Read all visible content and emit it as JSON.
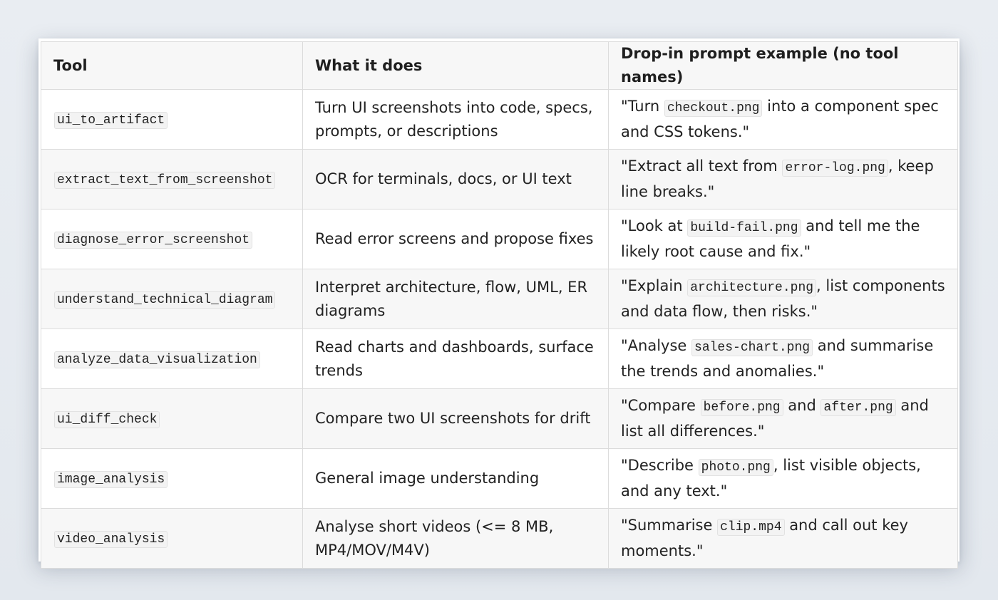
{
  "table": {
    "headers": {
      "tool": "Tool",
      "what": "What it does",
      "prompt": "Drop-in prompt example (no tool names)"
    },
    "rows": [
      {
        "tool": "ui_to_artifact",
        "description": "Turn UI screenshots into code, specs, prompts, or descriptions",
        "prompt": {
          "before": "\"Turn ",
          "file": "checkout.png",
          "after": " into a component spec and CSS tokens.\""
        }
      },
      {
        "tool": "extract_text_from_screenshot",
        "description": "OCR for terminals, docs, or UI text",
        "prompt": {
          "before": "\"Extract all text from ",
          "file": "error-log.png",
          "after": ", keep line breaks.\""
        }
      },
      {
        "tool": "diagnose_error_screenshot",
        "description": "Read error screens and propose fixes",
        "prompt": {
          "before": "\"Look at ",
          "file": "build-fail.png",
          "after": " and tell me the likely root cause and fix.\""
        }
      },
      {
        "tool": "understand_technical_diagram",
        "description": "Interpret architecture, flow, UML, ER diagrams",
        "prompt": {
          "before": "\"Explain ",
          "file": "architecture.png",
          "after": ", list components and data flow, then risks.\""
        }
      },
      {
        "tool": "analyze_data_visualization",
        "description": "Read charts and dashboards, surface trends",
        "prompt": {
          "before": "\"Analyse ",
          "file": "sales-chart.png",
          "after": " and summarise the trends and anomalies.\""
        }
      },
      {
        "tool": "ui_diff_check",
        "description": "Compare two UI screenshots for drift",
        "prompt": {
          "before": "\"Compare ",
          "file": "before.png",
          "middle": " and ",
          "file2": "after.png",
          "after": " and list all differences.\""
        }
      },
      {
        "tool": "image_analysis",
        "description": "General image understanding",
        "prompt": {
          "before": "\"Describe ",
          "file": "photo.png",
          "after": ", list visible objects, and any text.\""
        }
      },
      {
        "tool": "video_analysis",
        "description": "Analyse short videos (<= 8 MB, MP4/MOV/M4V)",
        "prompt": {
          "before": "\"Summarise ",
          "file": "clip.mp4",
          "after": " and call out key moments.\""
        }
      }
    ]
  }
}
